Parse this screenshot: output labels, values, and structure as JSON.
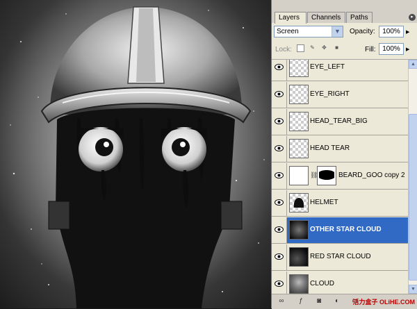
{
  "tabs": [
    {
      "label": "Layers",
      "active": true
    },
    {
      "label": "Channels",
      "active": false
    },
    {
      "label": "Paths",
      "active": false
    }
  ],
  "blend_mode": "Screen",
  "opacity_label": "Opacity:",
  "opacity_value": "100%",
  "lock_label": "Lock:",
  "fill_label": "Fill:",
  "fill_value": "100%",
  "layers": [
    {
      "name": "EYE_LEFT",
      "visible": true,
      "selected": false
    },
    {
      "name": "EYE_RIGHT",
      "visible": true,
      "selected": false
    },
    {
      "name": "HEAD_TEAR_BIG",
      "visible": true,
      "selected": false
    },
    {
      "name": "HEAD TEAR",
      "visible": true,
      "selected": false
    },
    {
      "name": "BEARD_GOO copy 2",
      "visible": true,
      "selected": false
    },
    {
      "name": "HELMET",
      "visible": true,
      "selected": false
    },
    {
      "name": "OTHER STAR CLOUD",
      "visible": true,
      "selected": true
    },
    {
      "name": "RED STAR CLOUD",
      "visible": true,
      "selected": false
    },
    {
      "name": "CLOUD",
      "visible": true,
      "selected": false
    }
  ],
  "watermark": "活力盒子 OLiHE.COM",
  "icons": {
    "eye": "eye-icon",
    "chain": "link-icon",
    "menu": "panel-menu-icon"
  },
  "colors": {
    "selection": "#316ac5",
    "panel_bg": "#ece9d8"
  }
}
